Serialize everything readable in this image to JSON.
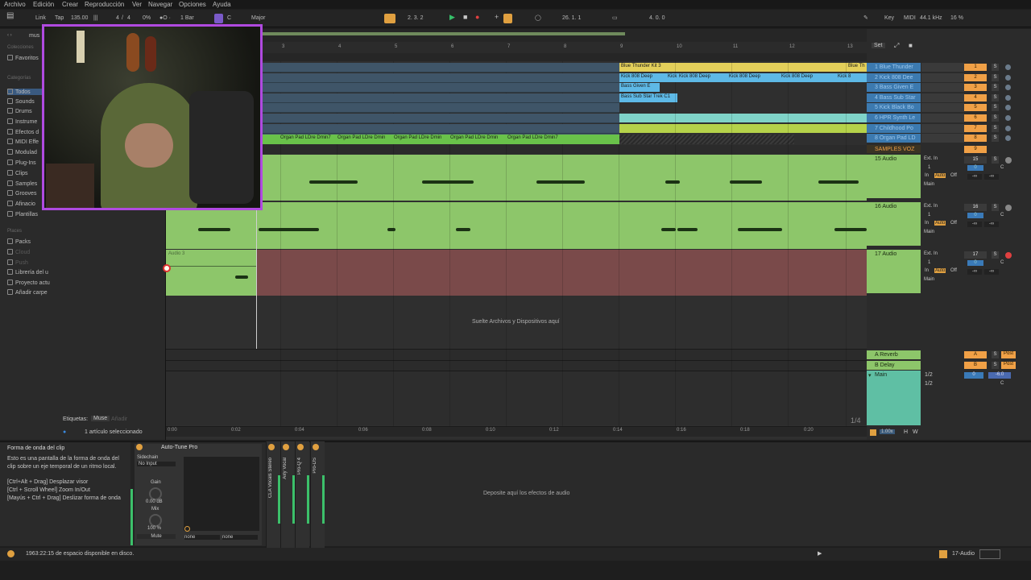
{
  "menubar": {
    "items": [
      "Archivo",
      "Edición",
      "Crear",
      "Reproducción",
      "Ver",
      "Navegar",
      "Opciones",
      "Ayuda"
    ]
  },
  "controls": {
    "link": "Link",
    "tap": "Tap",
    "tempo": "135.00",
    "meter_num": "4",
    "meter_sep": "/",
    "meter_den": "4",
    "cpu_small": "0%",
    "quantize": "1 Bar",
    "key": "C",
    "scale": "Major",
    "position": "2.  3.  2",
    "loop_start": "26.  1.  1",
    "loop_length": "4.  0.  0",
    "key_label": "Key",
    "midi_label": "MIDI",
    "sample_rate": "44.1 kHz",
    "cpu_percent": "16 %"
  },
  "browser": {
    "search_value": "mus",
    "collections_header": "Colecciones",
    "favorites": "Favoritos",
    "categories_header": "Categorías",
    "categories": [
      "Todos",
      "Sounds",
      "Drums",
      "Instrume",
      "Efectos d",
      "MIDI Effe",
      "Modulad",
      "Plug-Ins",
      "Clips",
      "Samples",
      "Grooves",
      "Afinacio",
      "Plantillas"
    ],
    "places_header": "Places",
    "places": [
      "Packs",
      "Cloud",
      "Push",
      "Librería del u",
      "Proyecto actu",
      "Añadir carpe"
    ],
    "tags_label": "Etiquetas:",
    "tag_value": "Muse",
    "tag_add": "Añadir",
    "selected_info": "1 artículo seleccionado"
  },
  "ruler": {
    "bars": [
      "3",
      "4",
      "5",
      "6",
      "7",
      "8",
      "9",
      "10",
      "11",
      "12",
      "13"
    ],
    "set_label": "Set"
  },
  "clips": {
    "blue_thunder": "Blue Thunder Kit 3",
    "blue_thunder_b": "Blue Th",
    "kick_clips": [
      "Kick 808 Deep",
      "Kick 808 Deep",
      "Kick 808 Deep",
      "Kick 808 Deep",
      "Kick 808 Deep",
      "Kick 8"
    ],
    "bass_given": "Bass Given E",
    "bass_sub": "Bass Sub Star Trek C1",
    "organ_clips": [
      "Organ Pad LDre Dmin7",
      "Organ Pad LDre Dmin",
      "Organ Pad LDre Dmin",
      "Organ Pad LDre Dmin",
      "Organ Pad LDre Dmin7"
    ],
    "audio3": "Audio 3"
  },
  "tracks": {
    "mini": [
      {
        "name": "1 Blue Thunder",
        "num": "1"
      },
      {
        "name": "2 Kick 808 Dee",
        "num": "2"
      },
      {
        "name": "3 Bass Given E",
        "num": "3"
      },
      {
        "name": "4 Bass Sub Star",
        "num": "4"
      },
      {
        "name": "5 Kick Black Bo",
        "num": "5"
      },
      {
        "name": "6 HPR Synth Le",
        "num": "6"
      },
      {
        "name": "7 Childhood Po",
        "num": "7"
      },
      {
        "name": "8 Organ Pad LD",
        "num": "8"
      }
    ],
    "samples_voz": {
      "name": "SAMPLES VOZ",
      "num": "9"
    },
    "audio": [
      {
        "name": "15 Audio",
        "num": "15",
        "input": "Ext. In",
        "channel": "1",
        "monitor_in": "In",
        "monitor_auto": "Auto",
        "monitor_off": "Off",
        "out": "Main",
        "vol": "0",
        "pan": "C",
        "send": "-∞"
      },
      {
        "name": "16 Audio",
        "num": "16",
        "input": "Ext. In",
        "channel": "1",
        "monitor_in": "In",
        "monitor_auto": "Auto",
        "monitor_off": "Off",
        "out": "Main",
        "vol": "0",
        "pan": "C",
        "send": "-∞"
      },
      {
        "name": "17 Audio",
        "num": "17",
        "input": "Ext. In",
        "channel": "1",
        "monitor_in": "In",
        "monitor_auto": "Auto",
        "monitor_off": "Off",
        "out": "Main",
        "vol": "0",
        "pan": "C",
        "send": "-∞"
      }
    ],
    "returns": [
      {
        "name": "A Reverb",
        "letter": "A",
        "post": "Post"
      },
      {
        "name": "B Delay",
        "letter": "B",
        "post": "Post"
      }
    ],
    "main": {
      "name": "Main",
      "io1": "1/2",
      "io2": "1/2",
      "vol": "0",
      "vol2": "-6.0",
      "pan": "C"
    }
  },
  "drop_text": "Suelte Archivos y Dispositivos aquí",
  "fraction": "1/4",
  "time_ticks": [
    "0:00",
    "0:02",
    "0:04",
    "0:06",
    "0:08",
    "0:10",
    "0:12",
    "0:14",
    "0:16",
    "0:18",
    "0:20"
  ],
  "zoom": "1.00x",
  "hw": {
    "h": "H",
    "w": "W"
  },
  "info": {
    "title": "Forma de onda del clip",
    "body": "Esto es una pantalla de la forma de onda del clip sobre un eje temporal de un ritmo local.",
    "hint1": "[Ctrl+Alt + Drag] Desplazar visor",
    "hint2": "[Ctrl + Scroll Wheel] Zoom In/Out",
    "hint3": "[Mayús + Ctrl + Drag] Deslizar forma de onda"
  },
  "device": {
    "name": "Auto-Tune Pro",
    "sidechain": "Sidechain",
    "sidechain_value": "No Input",
    "gain_label": "Gain",
    "gain_value": "0.00 dB",
    "mix_label": "Mix",
    "mix_value": "100 %",
    "mute": "Mute",
    "none1": "none",
    "none2": "none"
  },
  "chain": [
    "CLA Vocals Stereo",
    "Airy Vocal",
    "Pro-Q 4",
    "Pro-DS"
  ],
  "drop_fx": "Deposite aquí los efectos de audio",
  "status": {
    "disk": "1963:22:15 de espacio disponible en disco.",
    "track": "17-Audio"
  }
}
